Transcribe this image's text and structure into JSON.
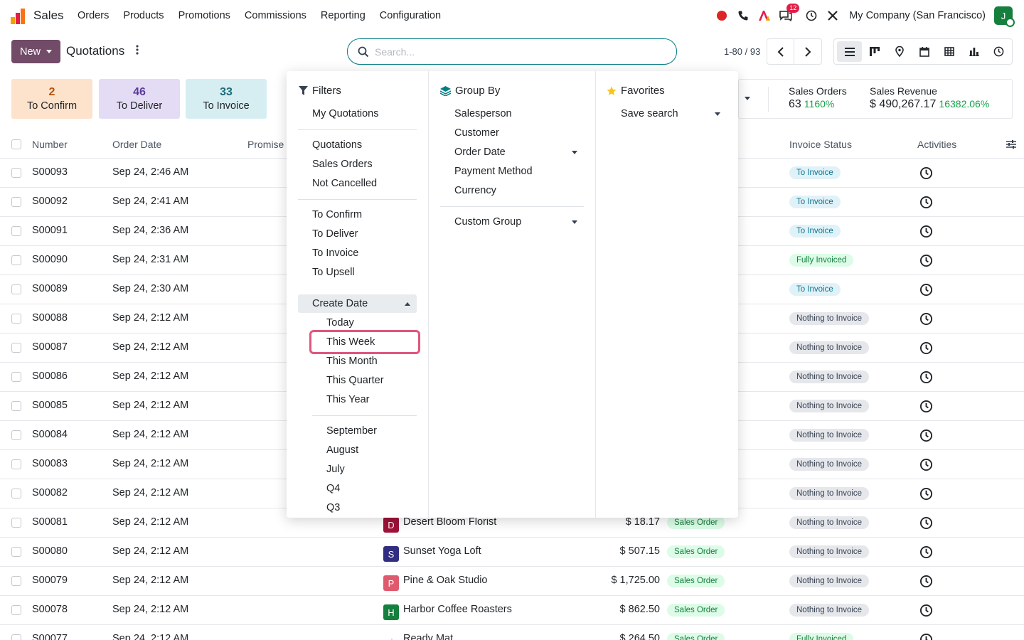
{
  "app": {
    "name": "Sales",
    "menu": [
      "Orders",
      "Products",
      "Promotions",
      "Commissions",
      "Reporting",
      "Configuration"
    ],
    "message_count": "12",
    "company": "My Company (San Francisco)",
    "user_initial": "J"
  },
  "control": {
    "new_label": "New",
    "breadcrumb": "Quotations",
    "search_placeholder": "Search...",
    "pager": "1-80 / 93"
  },
  "stats": [
    {
      "num": "2",
      "label": "To Confirm",
      "bg": "#fde2cc",
      "color": "#b45309"
    },
    {
      "num": "46",
      "label": "To Deliver",
      "bg": "#e4dcf5",
      "color": "#5b3c9a"
    },
    {
      "num": "33",
      "label": "To Invoice",
      "bg": "#d6eef2",
      "color": "#1b6b78"
    }
  ],
  "kpis": [
    {
      "label": "Sales Orders",
      "value": "63",
      "delta": "1160%"
    },
    {
      "label": "Sales Revenue",
      "value": "$ 490,267.17",
      "delta": "16382.06%"
    }
  ],
  "table": {
    "headers": {
      "number": "Number",
      "order_date": "Order Date",
      "promised": "Promise",
      "invoice_status": "Invoice Status",
      "activities": "Activities"
    },
    "rows": [
      {
        "number": "S00093",
        "date": "Sep 24, 2:46 AM",
        "invoice": "To Invoice"
      },
      {
        "number": "S00092",
        "date": "Sep 24, 2:41 AM",
        "invoice": "To Invoice"
      },
      {
        "number": "S00091",
        "date": "Sep 24, 2:36 AM",
        "invoice": "To Invoice"
      },
      {
        "number": "S00090",
        "date": "Sep 24, 2:31 AM",
        "invoice": "Fully Invoiced"
      },
      {
        "number": "S00089",
        "date": "Sep 24, 2:30 AM",
        "invoice": "To Invoice"
      },
      {
        "number": "S00088",
        "date": "Sep 24, 2:12 AM",
        "invoice": "Nothing to Invoice"
      },
      {
        "number": "S00087",
        "date": "Sep 24, 2:12 AM",
        "invoice": "Nothing to Invoice"
      },
      {
        "number": "S00086",
        "date": "Sep 24, 2:12 AM",
        "invoice": "Nothing to Invoice"
      },
      {
        "number": "S00085",
        "date": "Sep 24, 2:12 AM",
        "invoice": "Nothing to Invoice"
      },
      {
        "number": "S00084",
        "date": "Sep 24, 2:12 AM",
        "invoice": "Nothing to Invoice"
      },
      {
        "number": "S00083",
        "date": "Sep 24, 2:12 AM",
        "invoice": "Nothing to Invoice"
      },
      {
        "number": "S00082",
        "date": "Sep 24, 2:12 AM",
        "invoice": "Nothing to Invoice"
      },
      {
        "number": "S00081",
        "date": "Sep 24, 2:12 AM",
        "customer": "Desert Bloom Florist",
        "initial": "D",
        "av_color": "#9f1239",
        "total": "$ 18.17",
        "status": "Sales Order",
        "invoice": "Nothing to Invoice"
      },
      {
        "number": "S00080",
        "date": "Sep 24, 2:12 AM",
        "customer": "Sunset Yoga Loft",
        "initial": "S",
        "av_color": "#312e81",
        "total": "$ 507.15",
        "status": "Sales Order",
        "invoice": "Nothing to Invoice"
      },
      {
        "number": "S00079",
        "date": "Sep 24, 2:12 AM",
        "customer": "Pine & Oak Studio",
        "initial": "P",
        "av_color": "#e05a6d",
        "total": "$ 1,725.00",
        "status": "Sales Order",
        "invoice": "Nothing to Invoice"
      },
      {
        "number": "S00078",
        "date": "Sep 24, 2:12 AM",
        "customer": "Harbor Coffee Roasters",
        "initial": "H",
        "av_color": "#15803d",
        "total": "$ 862.50",
        "status": "Sales Order",
        "invoice": "Nothing to Invoice"
      },
      {
        "number": "S00077",
        "date": "Sep 24, 2:12 AM",
        "customer": "Ready Mat",
        "initial": "",
        "av_color": "#ffffff",
        "total": "$ 264.50",
        "status": "Sales Order",
        "invoice": "Fully Invoiced"
      }
    ]
  },
  "filters": {
    "title": "Filters",
    "group1": [
      "My Quotations"
    ],
    "group2": [
      "Quotations",
      "Sales Orders",
      "Not Cancelled"
    ],
    "group3": [
      "To Confirm",
      "To Deliver",
      "To Invoice",
      "To Upsell"
    ],
    "create_date": "Create Date",
    "periods": [
      "Today",
      "This Week",
      "This Month",
      "This Quarter",
      "This Year"
    ],
    "months": [
      "September",
      "August",
      "July",
      "Q4",
      "Q3"
    ]
  },
  "groupby": {
    "title": "Group By",
    "items": [
      "Salesperson",
      "Customer",
      "Order Date",
      "Payment Method",
      "Currency"
    ],
    "custom": "Custom Group"
  },
  "favorites": {
    "title": "Favorites",
    "save": "Save search"
  },
  "colors": {
    "brand": "#714b67",
    "accent": "#017e84",
    "highlight": "#e0567d"
  }
}
